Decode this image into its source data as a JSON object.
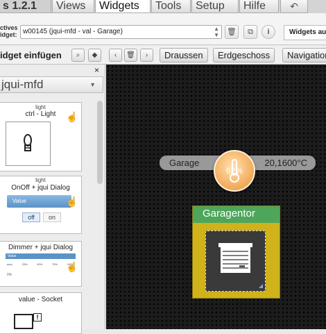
{
  "menu": {
    "version": "s 1.2.1",
    "tabs": [
      "Views",
      "Widgets",
      "Tools",
      "Setup",
      "Hilfe"
    ],
    "active_tab": "Widgets"
  },
  "toolbar": {
    "active_widget_label_line1": "ctives",
    "active_widget_label_line2": "idget:",
    "active_widget_value": "w00145 (jqui-mfd - val - Garage)",
    "widgets_aus_label": "Widgets aus"
  },
  "insert": {
    "title": "idget einfügen",
    "close": "×"
  },
  "views": {
    "buttons": [
      "Draussen",
      "Erdgeschoss",
      "Navigation"
    ]
  },
  "widget_set": {
    "selected": "jqui-mfd"
  },
  "palette": [
    {
      "tag": "light",
      "name": "ctrl - Light"
    },
    {
      "tag": "light",
      "name": "OnOff + jqui Dialog",
      "preview_value": "Value",
      "off": "off",
      "on": "on"
    },
    {
      "tag": "",
      "name": "Dimmer + jqui Dialog",
      "preview_value": "Value",
      "steps": [
        "auto",
        "25%",
        "50%",
        "75%",
        "100%"
      ],
      "zero": "0%"
    },
    {
      "tag": "",
      "name": "value - Socket"
    }
  ],
  "canvas": {
    "value_widget": {
      "name": "Garage",
      "value": "20,1600°C",
      "percent": "62%"
    },
    "garage_widget": {
      "title": "Garagentor"
    }
  },
  "colors": {
    "canvas_bg": "#1c1c1c",
    "garage_header": "#4ea65b",
    "garage_body": "#d0b21a",
    "thermo": "#f6b46a"
  }
}
